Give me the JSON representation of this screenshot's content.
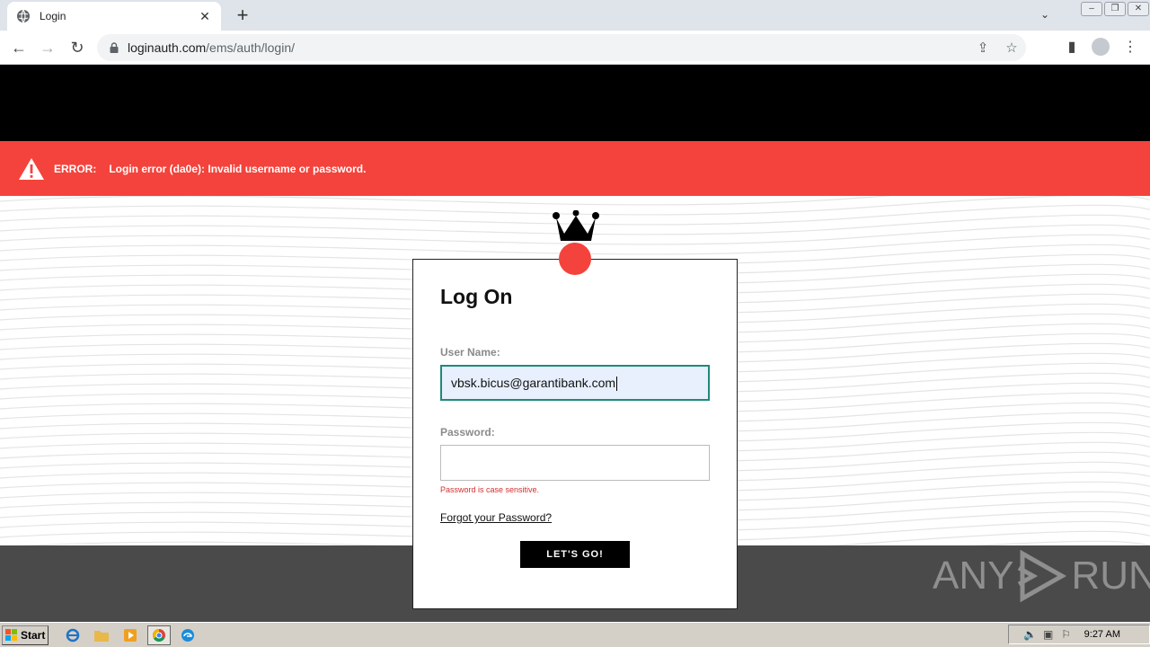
{
  "browser": {
    "tab_title": "Login",
    "tab_close": "✕",
    "new_tab": "+",
    "url_domain": "loginauth.com",
    "url_path": "/ems/auth/login/"
  },
  "page": {
    "error": {
      "label": "ERROR:",
      "message": "Login error (da0e): Invalid username or password."
    },
    "card": {
      "title": "Log On",
      "username_label": "User Name:",
      "username_value": "vbsk.bicus@garantibank.com",
      "password_label": "Password:",
      "password_value": "",
      "password_hint": "Password is case sensitive.",
      "forgot_link": "Forgot your Password?",
      "submit_label": "LET'S GO!"
    },
    "colors": {
      "accent_red": "#f4433c",
      "header_black": "#000000",
      "footer_gray": "#4a4a4a"
    }
  },
  "watermark": {
    "left": "ANY",
    "right": "RUN"
  },
  "taskbar": {
    "start_label": "Start",
    "clock": "9:27 AM"
  }
}
